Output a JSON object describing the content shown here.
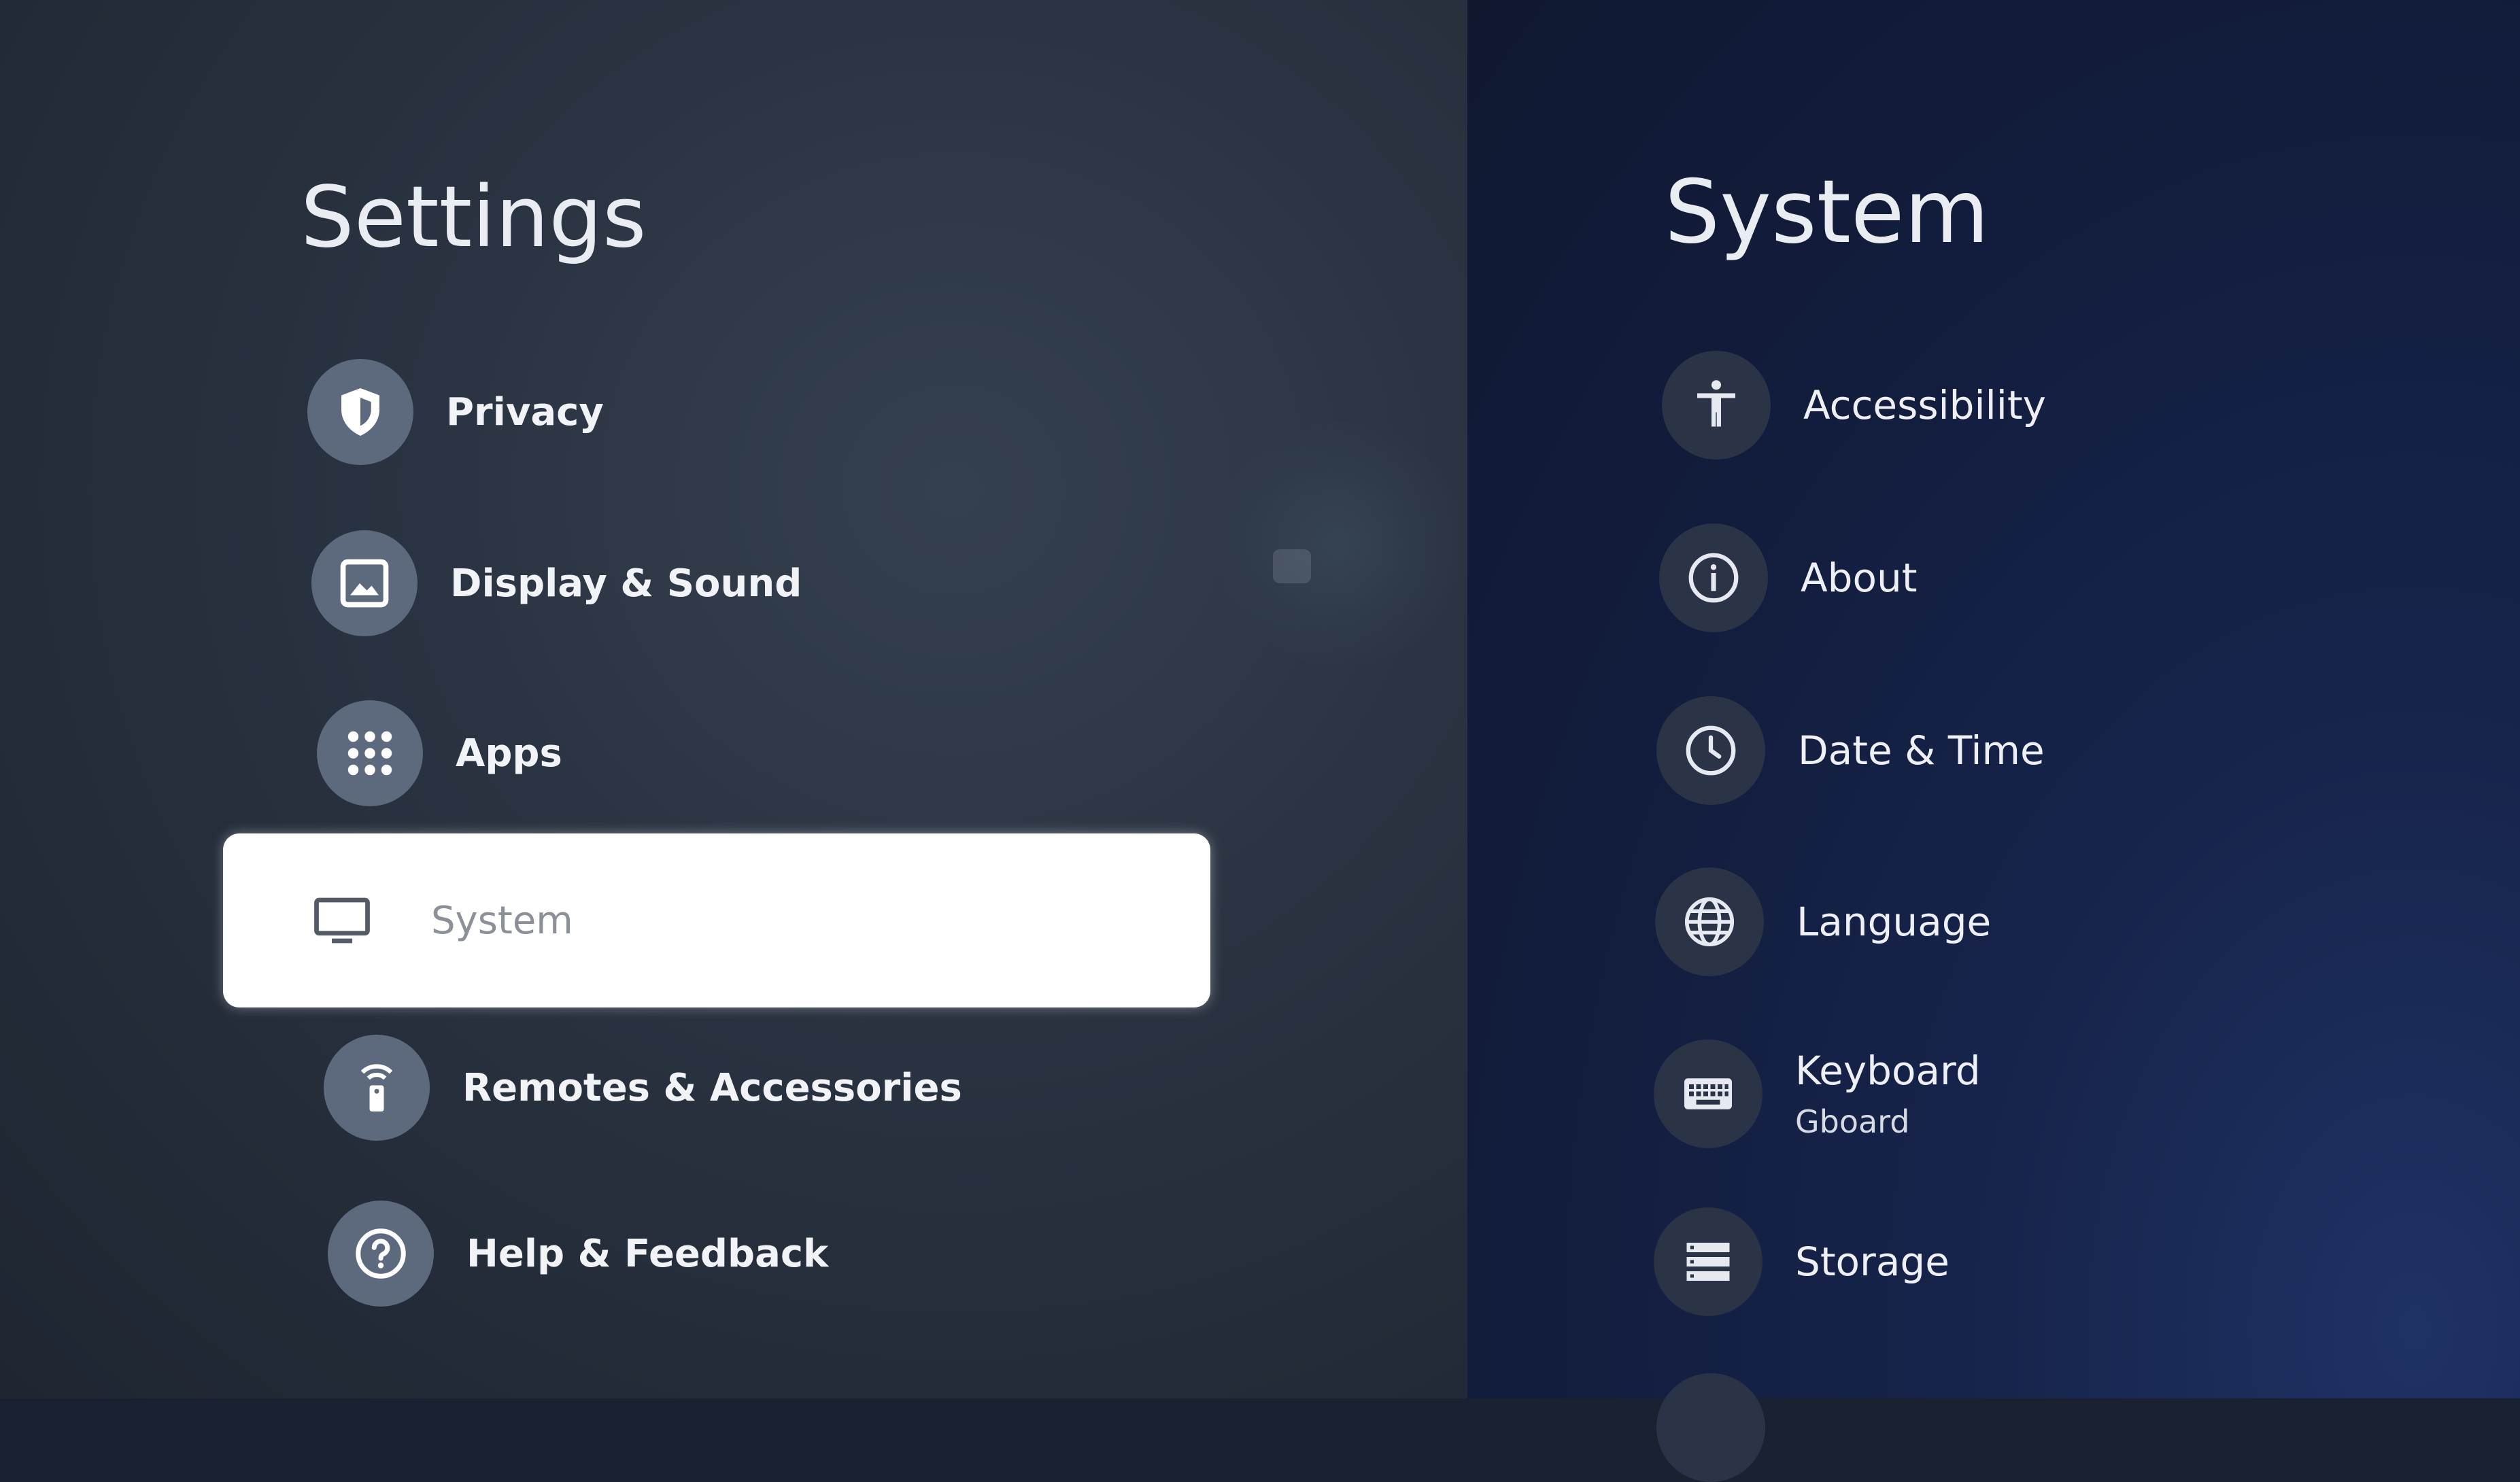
{
  "left": {
    "title": "Settings",
    "items": [
      {
        "label": "Privacy",
        "icon": "shield-icon"
      },
      {
        "label": "Display & Sound",
        "icon": "image-icon"
      },
      {
        "label": "Apps",
        "icon": "apps-grid-icon"
      },
      {
        "label": "System",
        "icon": "tv-icon",
        "selected": true
      },
      {
        "label": "Remotes & Accessories",
        "icon": "remote-icon"
      },
      {
        "label": "Help & Feedback",
        "icon": "help-icon"
      }
    ]
  },
  "right": {
    "title": "System",
    "items": [
      {
        "label": "Accessibility",
        "icon": "accessibility-icon"
      },
      {
        "label": "About",
        "icon": "info-icon"
      },
      {
        "label": "Date & Time",
        "icon": "clock-icon"
      },
      {
        "label": "Language",
        "icon": "globe-icon"
      },
      {
        "label": "Keyboard",
        "sublabel": "Gboard",
        "icon": "keyboard-icon"
      },
      {
        "label": "Storage",
        "icon": "storage-icon"
      }
    ]
  },
  "colors": {
    "selected_background": "#ffffff",
    "selected_text": "#8b9099",
    "icon_circle_left": "#5d6a7d",
    "icon_circle_right": "#2b3347"
  }
}
